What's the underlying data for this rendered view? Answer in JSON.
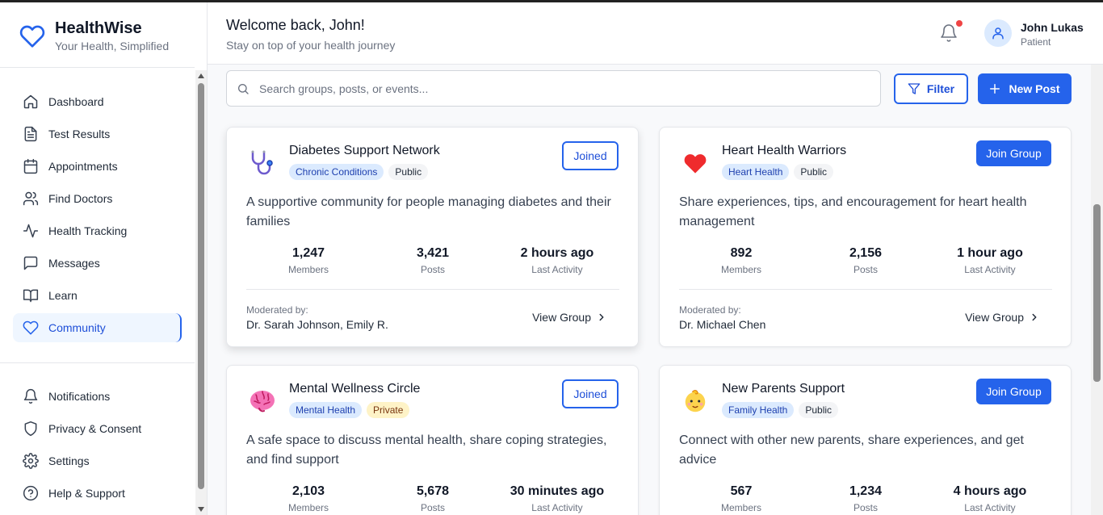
{
  "brand": {
    "title": "HealthWise",
    "subtitle": "Your Health, Simplified"
  },
  "nav": [
    {
      "label": "Dashboard",
      "icon": "home-icon"
    },
    {
      "label": "Test Results",
      "icon": "file-icon"
    },
    {
      "label": "Appointments",
      "icon": "calendar-icon"
    },
    {
      "label": "Find Doctors",
      "icon": "users-icon"
    },
    {
      "label": "Health Tracking",
      "icon": "activity-icon"
    },
    {
      "label": "Messages",
      "icon": "message-icon"
    },
    {
      "label": "Learn",
      "icon": "book-icon"
    },
    {
      "label": "Community",
      "icon": "heart-icon",
      "active": true
    }
  ],
  "nav_bottom": [
    {
      "label": "Notifications",
      "icon": "bell-icon"
    },
    {
      "label": "Privacy & Consent",
      "icon": "shield-icon"
    },
    {
      "label": "Settings",
      "icon": "gear-icon"
    },
    {
      "label": "Help & Support",
      "icon": "help-icon"
    }
  ],
  "header": {
    "welcome": "Welcome back, John!",
    "subtitle": "Stay on top of your health journey",
    "user_name": "John Lukas",
    "user_role": "Patient"
  },
  "search": {
    "placeholder": "Search groups, posts, or events...",
    "value": ""
  },
  "actions": {
    "filter": "Filter",
    "new_post": "New Post"
  },
  "labels": {
    "members": "Members",
    "posts": "Posts",
    "last_activity": "Last Activity",
    "moderated_by": "Moderated by:",
    "view_group": "View Group",
    "joined": "Joined",
    "join_group": "Join Group"
  },
  "groups": [
    {
      "title": "Diabetes Support Network",
      "icon": "stethoscope-icon",
      "category": "Chronic Conditions",
      "privacy": "Public",
      "joined": true,
      "description": "A supportive community for people managing diabetes and their families",
      "members": "1,247",
      "posts": "3,421",
      "last_activity": "2 hours ago",
      "moderators": "Dr. Sarah Johnson, Emily R."
    },
    {
      "title": "Heart Health Warriors",
      "icon": "red-heart-icon",
      "category": "Heart Health",
      "privacy": "Public",
      "joined": false,
      "description": "Share experiences, tips, and encouragement for heart health management",
      "members": "892",
      "posts": "2,156",
      "last_activity": "1 hour ago",
      "moderators": "Dr. Michael Chen"
    },
    {
      "title": "Mental Wellness Circle",
      "icon": "brain-icon",
      "category": "Mental Health",
      "privacy": "Private",
      "joined": true,
      "description": "A safe space to discuss mental health, share coping strategies, and find support",
      "members": "2,103",
      "posts": "5,678",
      "last_activity": "30 minutes ago"
    },
    {
      "title": "New Parents Support",
      "icon": "baby-icon",
      "category": "Family Health",
      "privacy": "Public",
      "joined": false,
      "description": "Connect with other new parents, share experiences, and get advice",
      "members": "567",
      "posts": "1,234",
      "last_activity": "4 hours ago"
    }
  ]
}
